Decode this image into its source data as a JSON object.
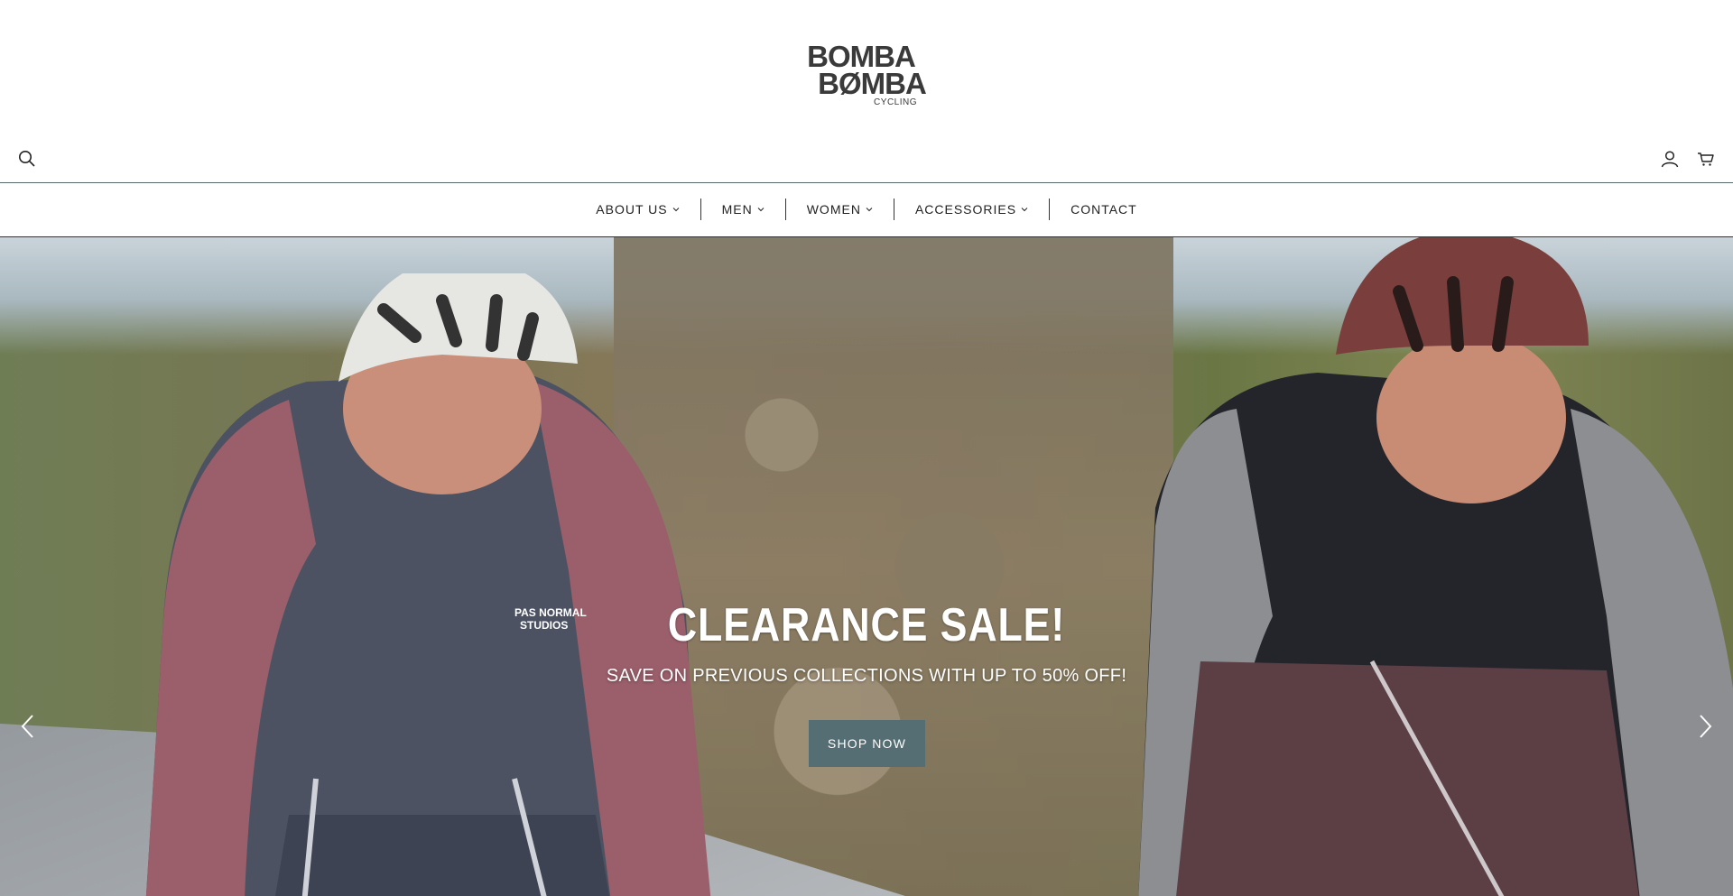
{
  "brand": {
    "line1": "BOMBA",
    "line2": "BØMBA",
    "line3": "CYCLING"
  },
  "header": {
    "search_icon": "search-icon",
    "account_icon": "user-icon",
    "cart_icon": "cart-icon"
  },
  "nav": {
    "items": [
      {
        "label": "ABOUT US",
        "has_dropdown": true
      },
      {
        "label": "MEN",
        "has_dropdown": true
      },
      {
        "label": "WOMEN",
        "has_dropdown": true
      },
      {
        "label": "ACCESSORIES",
        "has_dropdown": true
      },
      {
        "label": "CONTACT",
        "has_dropdown": false
      }
    ]
  },
  "hero": {
    "title": "CLEARANCE SALE!",
    "subtitle": "SAVE ON PREVIOUS COLLECTIONS WITH UP TO 50% OFF!",
    "button_label": "SHOP NOW",
    "button_color": "#546e73",
    "prev_icon": "chevron-left-icon",
    "next_icon": "chevron-right-icon"
  }
}
